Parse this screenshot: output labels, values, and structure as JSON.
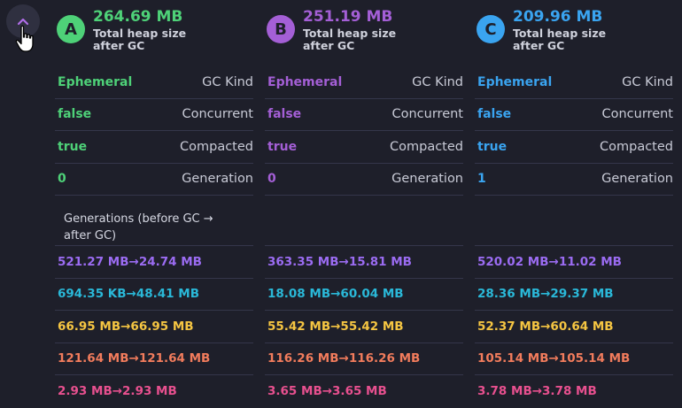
{
  "columns": [
    {
      "badge": "A",
      "color": "#4ed178",
      "heap_value": "264.69 MB",
      "heap_caption": "Total heap size after GC",
      "props": [
        {
          "value": "Ephemeral",
          "key": "GC Kind"
        },
        {
          "value": "false",
          "key": "Concurrent"
        },
        {
          "value": "true",
          "key": "Compacted"
        },
        {
          "value": "0",
          "key": "Generation"
        }
      ],
      "gen_title": "Generations (before GC → after GC)",
      "generations": [
        {
          "text": "521.27 MB→24.74 MB",
          "color": "#9b6cf2"
        },
        {
          "text": "694.35 KB→48.41 MB",
          "color": "#2ab8d8"
        },
        {
          "text": "66.95 MB→66.95 MB",
          "color": "#f5c542"
        },
        {
          "text": "121.64 MB→121.64 MB",
          "color": "#f27c5c"
        },
        {
          "text": "2.93 MB→2.93 MB",
          "color": "#e8508f"
        }
      ]
    },
    {
      "badge": "B",
      "color": "#a45fd6",
      "heap_value": "251.19 MB",
      "heap_caption": "Total heap size after GC",
      "props": [
        {
          "value": "Ephemeral",
          "key": "GC Kind"
        },
        {
          "value": "false",
          "key": "Concurrent"
        },
        {
          "value": "true",
          "key": "Compacted"
        },
        {
          "value": "0",
          "key": "Generation"
        }
      ],
      "generations": [
        {
          "text": "363.35 MB→15.81 MB",
          "color": "#9b6cf2"
        },
        {
          "text": "18.08 MB→60.04 MB",
          "color": "#2ab8d8"
        },
        {
          "text": "55.42 MB→55.42 MB",
          "color": "#f5c542"
        },
        {
          "text": "116.26 MB→116.26 MB",
          "color": "#f27c5c"
        },
        {
          "text": "3.65 MB→3.65 MB",
          "color": "#e8508f"
        }
      ]
    },
    {
      "badge": "C",
      "color": "#3aa4f0",
      "heap_value": "209.96 MB",
      "heap_caption": "Total heap size after GC",
      "props": [
        {
          "value": "Ephemeral",
          "key": "GC Kind"
        },
        {
          "value": "false",
          "key": "Concurrent"
        },
        {
          "value": "true",
          "key": "Compacted"
        },
        {
          "value": "1",
          "key": "Generation"
        }
      ],
      "generations": [
        {
          "text": "520.02 MB→11.02 MB",
          "color": "#9b6cf2"
        },
        {
          "text": "28.36 MB→29.37 MB",
          "color": "#2ab8d8"
        },
        {
          "text": "52.37 MB→60.64 MB",
          "color": "#f5c542"
        },
        {
          "text": "105.14 MB→105.14 MB",
          "color": "#f27c5c"
        },
        {
          "text": "3.78 MB→3.78 MB",
          "color": "#e8508f"
        }
      ]
    }
  ],
  "icons": {
    "collapse": "chevron-up-icon",
    "cursor": "hand-pointer-icon"
  },
  "colors": {
    "background": "#1e1f2a",
    "button": "#2f3040",
    "chevron": "#b06ee8"
  }
}
